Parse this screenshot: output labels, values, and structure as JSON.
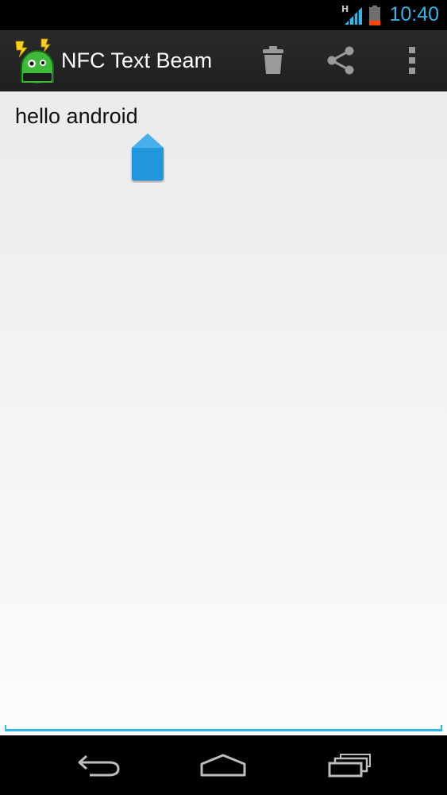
{
  "status_bar": {
    "network_type": "H",
    "clock": "10:40",
    "icons": [
      "signal-icon",
      "battery-icon"
    ],
    "battery_level": 0.2
  },
  "action_bar": {
    "title": "NFC Text Beam",
    "app_icon": "android-nfc-app-icon",
    "actions": [
      {
        "name": "delete",
        "icon": "trash-icon"
      },
      {
        "name": "share",
        "icon": "share-icon"
      },
      {
        "name": "overflow-menu",
        "icon": "more-vertical-icon"
      }
    ]
  },
  "editor": {
    "value": "hello android"
  },
  "navigation": {
    "buttons": [
      {
        "name": "back",
        "icon": "back-icon"
      },
      {
        "name": "home",
        "icon": "home-icon"
      },
      {
        "name": "recents",
        "icon": "recents-icon"
      }
    ]
  },
  "colors": {
    "accent": "#33b5e5",
    "action_bar": "#222222",
    "content_bg": "#f2f2f2",
    "battery_low": "#ff4400",
    "cursor_handle": "#1e90d8"
  }
}
